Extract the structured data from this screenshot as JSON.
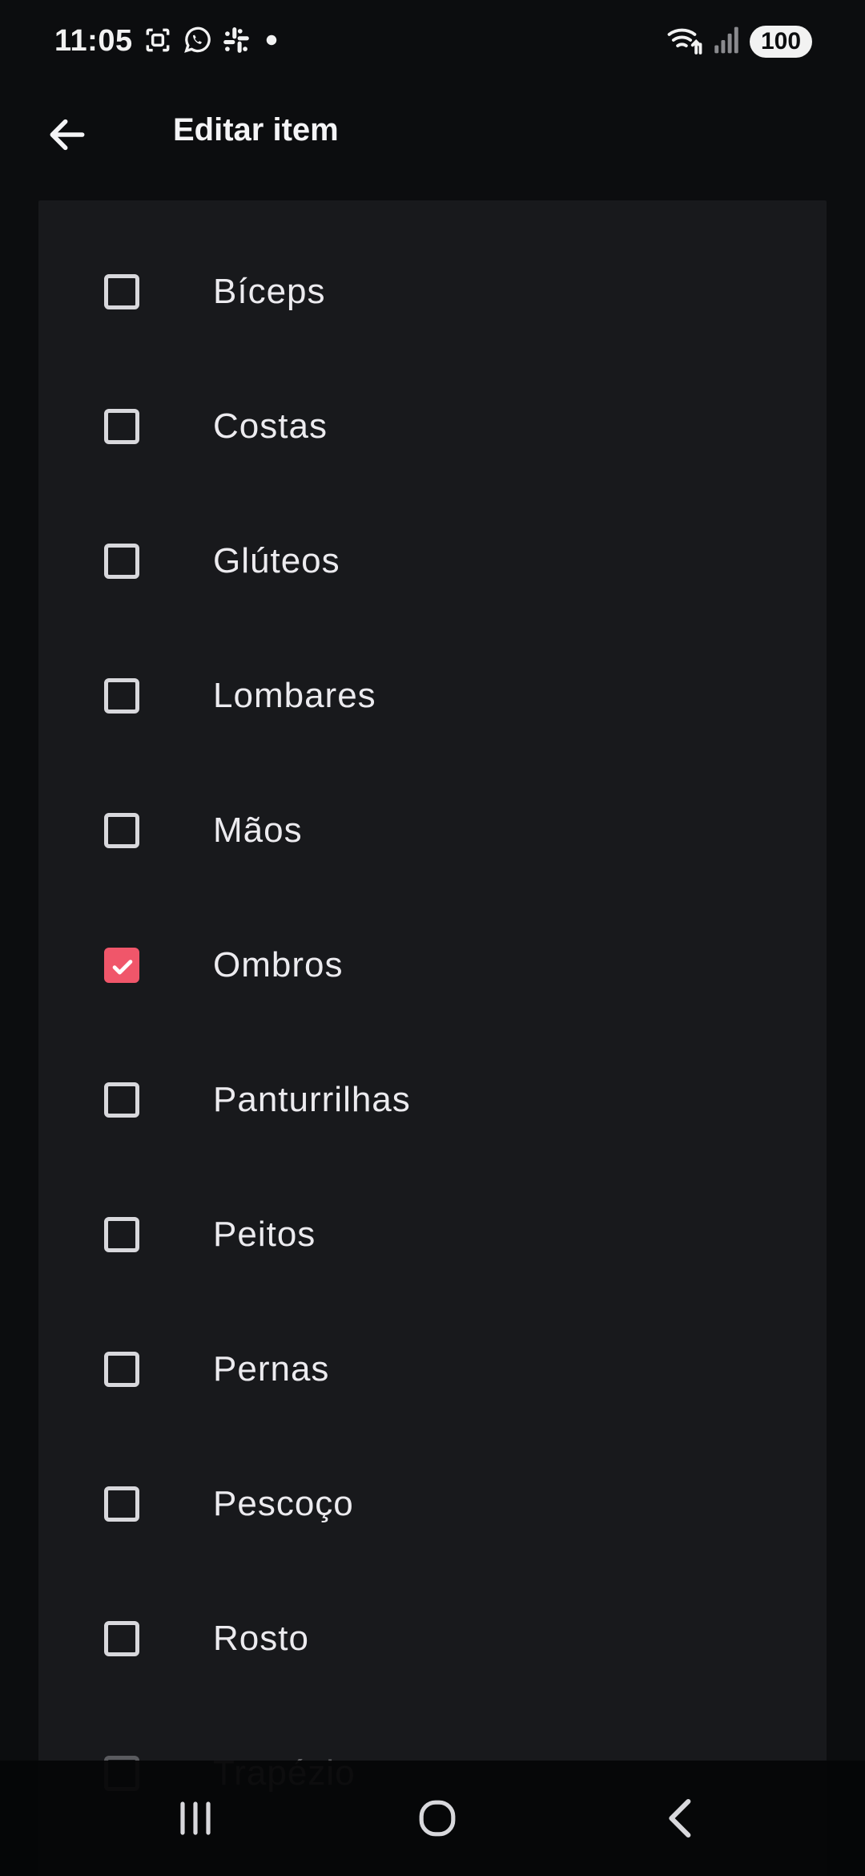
{
  "status_bar": {
    "time": "11:05",
    "left_icons": [
      "screenshot-icon",
      "whatsapp-icon",
      "slack-icon",
      "dot-icon"
    ],
    "right_icons": [
      "wifi-icon",
      "signal-icon"
    ],
    "battery": "100"
  },
  "app_bar": {
    "back_icon": "arrow-left-icon",
    "title": "Editar item"
  },
  "items": [
    {
      "label": "Bíceps",
      "checked": false
    },
    {
      "label": "Costas",
      "checked": false
    },
    {
      "label": "Glúteos",
      "checked": false
    },
    {
      "label": "Lombares",
      "checked": false
    },
    {
      "label": "Mãos",
      "checked": false
    },
    {
      "label": "Ombros",
      "checked": true
    },
    {
      "label": "Panturrilhas",
      "checked": false
    },
    {
      "label": "Peitos",
      "checked": false
    },
    {
      "label": "Pernas",
      "checked": false
    },
    {
      "label": "Pescoço",
      "checked": false
    },
    {
      "label": "Rosto",
      "checked": false
    },
    {
      "label": "Trapézio",
      "checked": false
    }
  ],
  "nav_bar": {
    "recents_icon": "recents-icon",
    "home_icon": "home-icon",
    "back_icon": "back-chevron-icon"
  },
  "colors": {
    "accent": "#f0566a",
    "background": "#0c0d0f",
    "card": "#18191c"
  }
}
